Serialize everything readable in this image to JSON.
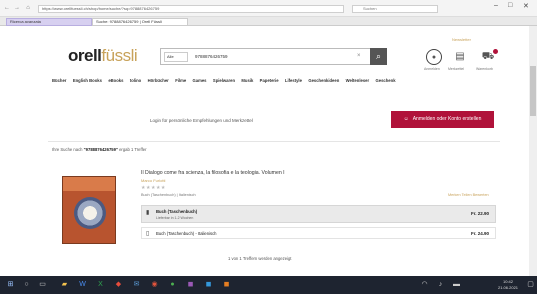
{
  "browser": {
    "url": "https://www.orellfuessli.ch/shop/home/suche/?sq=9788876426759",
    "search_placeholder": "Suchen",
    "tabs": [
      {
        "label": "Ricerca avanzata"
      },
      {
        "label": "Suche: 9788876426759 | Orell Füssli"
      }
    ]
  },
  "header": {
    "logo_main": "orell",
    "logo_accent": "füssli",
    "top_link": "Newsletter",
    "category": "Alle",
    "search_value": "9788876426759",
    "icons": [
      {
        "name": "account-icon",
        "label": "Anmelden"
      },
      {
        "name": "wishlist-icon",
        "label": "Merkzettel"
      },
      {
        "name": "cart-icon",
        "label": "Warenkorb"
      }
    ]
  },
  "nav": {
    "items": [
      "Bücher",
      "English Books",
      "eBooks",
      "tolino",
      "Hörbücher",
      "Filme",
      "Games",
      "Spielwaren",
      "Musik",
      "Papeterie",
      "Lifestyle",
      "Geschenkideen",
      "Weltenleser",
      "Geschenk"
    ]
  },
  "login_banner": {
    "text": "Login für persönliche Empfehlungen und Merkzettel",
    "cta_label": "Anmelden oder Konto erstellen"
  },
  "results": {
    "prefix": "Ihre Suche nach",
    "query": "\"9788876426759\"",
    "suffix": "ergab 1 Treffer",
    "item": {
      "title": "Il Dialogo come fra scienza, la filosofia e la teologia. Volumen I",
      "author": "Marco Furlotti",
      "stars": "★★★★★",
      "meta": "Buch (Taschenbuch) | Italienisch",
      "wishlist": "Merken  Teilen  Bewerten",
      "offers": [
        {
          "type": "Buch (Taschenbuch)",
          "note": "Lieferbar in 1-2 Wochen",
          "price": "Fr. 22.90"
        },
        {
          "type": "Buch (Taschenbuch) - Italienisch",
          "price": "Fr. 24.90"
        }
      ]
    },
    "pager": "1 von 1 Treffern werden angezeigt"
  },
  "taskbar": {
    "time": "10:42",
    "date": "21.06.2021"
  }
}
